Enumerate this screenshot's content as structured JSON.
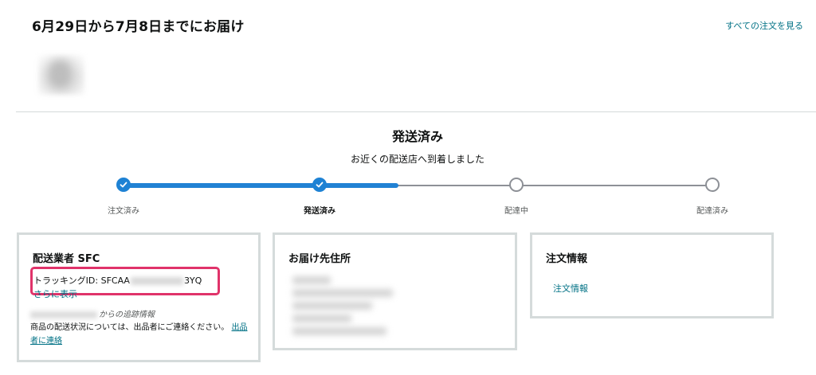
{
  "header": {
    "delivery_title": "6月29日から7月8日までにお届け",
    "all_orders_link": "すべての注文を見る"
  },
  "shipment": {
    "status_heading": "発送済み",
    "status_sub": "お近くの配送店へ到着しました",
    "progress_fraction": 0.47,
    "steps": [
      {
        "label": "注文済み",
        "state": "done"
      },
      {
        "label": "発送済み",
        "state": "done"
      },
      {
        "label": "配達中",
        "state": "todo"
      },
      {
        "label": "配達済み",
        "state": "todo"
      }
    ]
  },
  "carrier_card": {
    "title": "配送業者 SFC",
    "tracking_prefix": "トラッキングID: SFCAA",
    "tracking_suffix": "3YQ",
    "show_more": "さらに表示",
    "track_info_suffix": "からの追跡情報",
    "note": "商品の配送状況については、出品者にご連絡ください。",
    "contact_link": "出品者に連絡"
  },
  "address_card": {
    "title": "お届け先住所"
  },
  "order_info_card": {
    "title": "注文情報",
    "link": "注文情報"
  },
  "colors": {
    "accent_blue": "#1e82d4",
    "link_teal": "#007185",
    "highlight_pink": "#e0336a",
    "card_border": "#d5dbdb"
  }
}
